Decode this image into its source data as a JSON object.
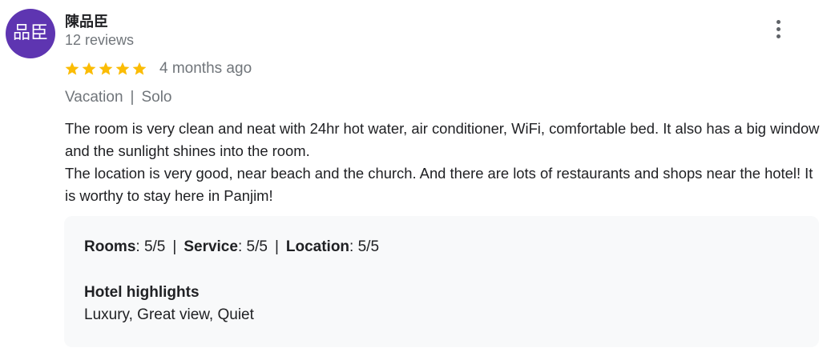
{
  "author": {
    "avatar_text": "品臣",
    "avatar_color": "#5e35b1",
    "name": "陳品臣",
    "review_count": "12 reviews"
  },
  "menu": {
    "icon": "more-vert-icon"
  },
  "rating": {
    "stars": 5,
    "max_stars": 5,
    "star_color": "#fbbc04",
    "time_ago": "4 months ago"
  },
  "trip": {
    "type": "Vacation",
    "separator": "|",
    "companion": "Solo"
  },
  "review": {
    "paragraphs": [
      "The room is very clean and neat with 24hr hot water, air conditioner, WiFi, comfortable bed. It also has a big window and the sunlight shines into the room.",
      "The location is very good, near beach and the church. And there are lots of restaurants and shops near the hotel! It is worthy to stay here in Panjim!"
    ]
  },
  "details": {
    "ratings": [
      {
        "label": "Rooms",
        "value": ": 5/5"
      },
      {
        "label": "Service",
        "value": ": 5/5"
      },
      {
        "label": "Location",
        "value": ": 5/5"
      }
    ],
    "separator": "|",
    "highlights_title": "Hotel highlights",
    "highlights": "Luxury, Great view, Quiet"
  }
}
